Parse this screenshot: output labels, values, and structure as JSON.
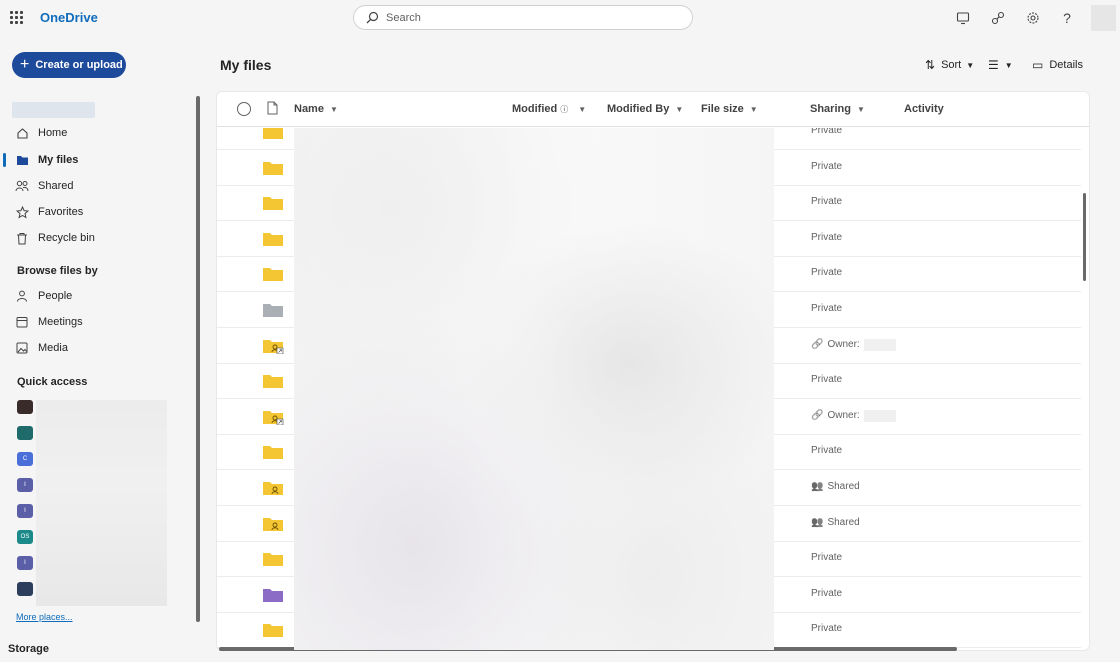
{
  "app": {
    "title": "OneDrive"
  },
  "search": {
    "placeholder": "Search"
  },
  "toolbar_icons": [
    "monitor-icon",
    "diamond-icon",
    "gear-icon",
    "help-icon"
  ],
  "sidebar": {
    "create_label": "Create or upload",
    "nav": [
      {
        "label": "Home",
        "icon": "home-icon"
      },
      {
        "label": "My files",
        "icon": "folder-icon",
        "active": true
      },
      {
        "label": "Shared",
        "icon": "people-icon"
      },
      {
        "label": "Favorites",
        "icon": "star-icon"
      },
      {
        "label": "Recycle bin",
        "icon": "trash-icon"
      }
    ],
    "browse_heading": "Browse files by",
    "browse": [
      {
        "label": "People",
        "icon": "person-icon"
      },
      {
        "label": "Meetings",
        "icon": "calendar-icon"
      },
      {
        "label": "Media",
        "icon": "image-icon"
      }
    ],
    "quick_access_heading": "Quick access",
    "quick_access_icons": [
      {
        "color": "#3a2b2b",
        "glyph": ""
      },
      {
        "color": "#1f6a6a",
        "glyph": ""
      },
      {
        "color": "#4a6fd8",
        "glyph": "C"
      },
      {
        "color": "#5b5fa8",
        "glyph": "I"
      },
      {
        "color": "#5b5fa8",
        "glyph": "I"
      },
      {
        "color": "#1c8a8a",
        "glyph": "OS"
      },
      {
        "color": "#5b5fa8",
        "glyph": "I"
      },
      {
        "color": "#2c3e5c",
        "glyph": ""
      }
    ],
    "more_places": "More places...",
    "storage": "Storage"
  },
  "main": {
    "title": "My files",
    "commands": {
      "sort": "Sort",
      "details": "Details"
    },
    "columns": {
      "name": "Name",
      "modified": "Modified",
      "modified_by": "Modified By",
      "file_size": "File size",
      "sharing": "Sharing",
      "activity": "Activity"
    },
    "rows": [
      {
        "folder": "yellow",
        "sharing": "Private"
      },
      {
        "folder": "yellow",
        "sharing": "Private"
      },
      {
        "folder": "yellow",
        "sharing": "Private"
      },
      {
        "folder": "yellow",
        "sharing": "Private"
      },
      {
        "folder": "yellow",
        "sharing": "Private"
      },
      {
        "folder": "gray",
        "sharing": "Private"
      },
      {
        "folder": "shared-link",
        "sharing": "Owner:"
      },
      {
        "folder": "yellow",
        "sharing": "Private"
      },
      {
        "folder": "shared-link",
        "sharing": "Owner:"
      },
      {
        "folder": "yellow",
        "sharing": "Private"
      },
      {
        "folder": "shared",
        "sharing": "Shared"
      },
      {
        "folder": "shared",
        "sharing": "Shared"
      },
      {
        "folder": "yellow",
        "sharing": "Private"
      },
      {
        "folder": "purple",
        "sharing": "Private"
      },
      {
        "folder": "yellow",
        "sharing": "Private"
      }
    ]
  }
}
